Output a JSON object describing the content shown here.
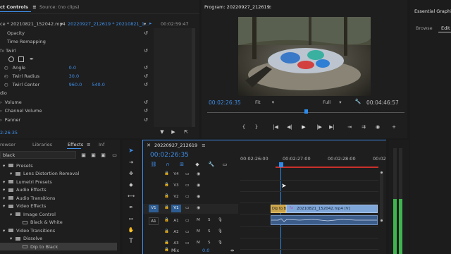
{
  "effect_controls": {
    "tab_label": "ct Controls",
    "source_tab": "Source: (no clips)",
    "master_clip": "ce * 20210821_152042.mp4",
    "sequence_clip": "20220927_212619 * 20210821_1...",
    "timecode_top": "00:02:59:47",
    "timecode_bottom": "2:26:35",
    "properties": [
      {
        "label": "Opacity"
      },
      {
        "label": "Time Remapping"
      },
      {
        "label": "Twirl",
        "header": true
      },
      {
        "label": "Angle",
        "value": "0.0"
      },
      {
        "label": "Twirl Radius",
        "value": "30.0"
      },
      {
        "label": "Twirl Center",
        "value": "960.0",
        "value2": "540.0"
      },
      {
        "label": "dio",
        "header": true
      },
      {
        "label": "Volume"
      },
      {
        "label": "Channel Volume"
      },
      {
        "label": "Panner"
      }
    ]
  },
  "program_monitor": {
    "title": "Program: 20220927_212619",
    "timecode": "00:02:26:35",
    "fit": "Fit",
    "quality": "Full",
    "duration": "00:04:46:57"
  },
  "essential_graphics": {
    "title": "Essential Graphics",
    "tab_browse": "Browse",
    "tab_edit": "Edit"
  },
  "effects_panel": {
    "tabs": [
      "rowser",
      "Libraries",
      "Effects",
      "Inf"
    ],
    "active_tab": "Effects",
    "search_value": "black",
    "tree": [
      {
        "label": "Presets",
        "level": 0,
        "folder": true
      },
      {
        "label": "Lens Distortion Removal",
        "level": 1,
        "folder": true
      },
      {
        "label": "Lumetri Presets",
        "level": 0,
        "folder": true
      },
      {
        "label": "Audio Effects",
        "level": 0,
        "folder": true
      },
      {
        "label": "Audio Transitions",
        "level": 0,
        "folder": true
      },
      {
        "label": "Video Effects",
        "level": 0,
        "folder": true
      },
      {
        "label": "Image Control",
        "level": 1,
        "folder": true
      },
      {
        "label": "Black & White",
        "level": 2,
        "folder": false
      },
      {
        "label": "Video Transitions",
        "level": 0,
        "folder": true
      },
      {
        "label": "Dissolve",
        "level": 1,
        "folder": true
      },
      {
        "label": "Dip to Black",
        "level": 2,
        "folder": false,
        "selected": true
      }
    ]
  },
  "timeline": {
    "sequence_tab": "20220927_212619",
    "timecode": "00:02:26:35",
    "ruler": [
      "00:02:26:00",
      "00:02:27:00",
      "00:02:28:00",
      "00:02:29:00"
    ],
    "video_tracks": [
      "V4",
      "V3",
      "V2",
      "V1"
    ],
    "audio_tracks": [
      "A1",
      "A2",
      "A3"
    ],
    "source_v": "V1",
    "source_a": "A1",
    "mix_label": "Mix",
    "mix_value": "0.0",
    "transition_label": "Dip to B",
    "clip_label": "20210821_152042.mp4 [V]",
    "fx_badge": "fx",
    "m_label": "M",
    "s_label": "S"
  },
  "colors": {
    "accent": "#2d8ceb",
    "clip_video": "#7fa6d8",
    "transition": "#c9a24a",
    "clip_audio": "#3c5c8a"
  }
}
